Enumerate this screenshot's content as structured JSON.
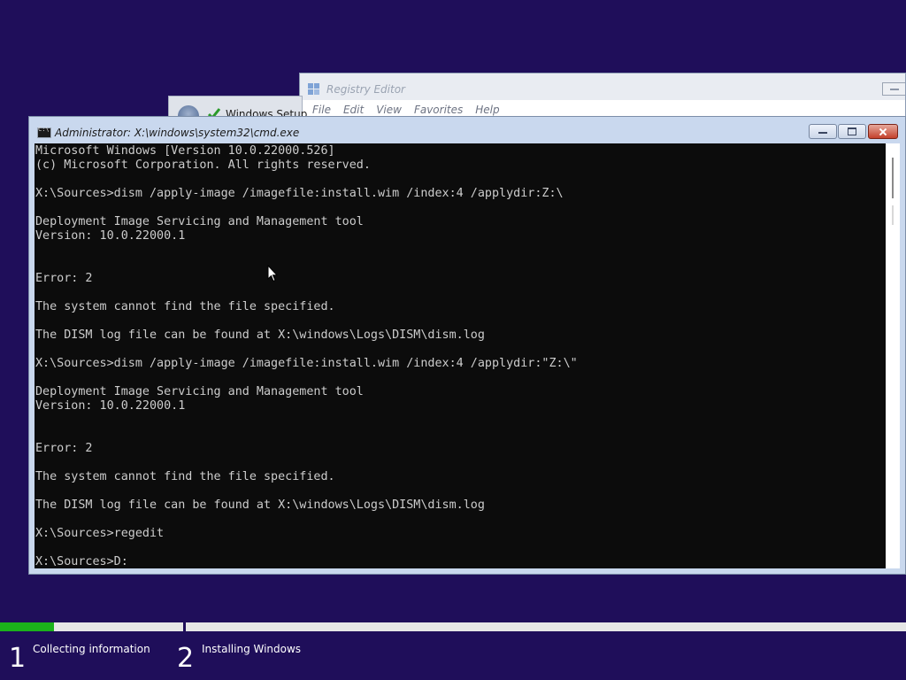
{
  "registry_editor": {
    "title": "Registry Editor",
    "menu": [
      "File",
      "Edit",
      "View",
      "Favorites",
      "Help"
    ]
  },
  "windows_setup": {
    "title": "Windows Setup"
  },
  "cmd": {
    "title": "Administrator: X:\\windows\\system32\\cmd.exe",
    "lines": [
      "Microsoft Windows [Version 10.0.22000.526]",
      "(c) Microsoft Corporation. All rights reserved.",
      "",
      "X:\\Sources>dism /apply-image /imagefile:install.wim /index:4 /applydir:Z:\\",
      "",
      "Deployment Image Servicing and Management tool",
      "Version: 10.0.22000.1",
      "",
      "",
      "Error: 2",
      "",
      "The system cannot find the file specified.",
      "",
      "The DISM log file can be found at X:\\windows\\Logs\\DISM\\dism.log",
      "",
      "X:\\Sources>dism /apply-image /imagefile:install.wim /index:4 /applydir:\"Z:\\\"",
      "",
      "Deployment Image Servicing and Management tool",
      "Version: 10.0.22000.1",
      "",
      "",
      "Error: 2",
      "",
      "The system cannot find the file specified.",
      "",
      "The DISM log file can be found at X:\\windows\\Logs\\DISM\\dism.log",
      "",
      "X:\\Sources>regedit",
      "",
      "X:\\Sources>D:"
    ]
  },
  "setup_progress": {
    "fraction": 0.06,
    "steps": [
      {
        "number": "1",
        "label": "Collecting information"
      },
      {
        "number": "2",
        "label": "Installing Windows"
      }
    ]
  },
  "colors": {
    "desktop": "#1f0e5a",
    "progress": "#1bb11b",
    "console_bg": "#0c0c0c",
    "console_text": "#cccccc"
  }
}
